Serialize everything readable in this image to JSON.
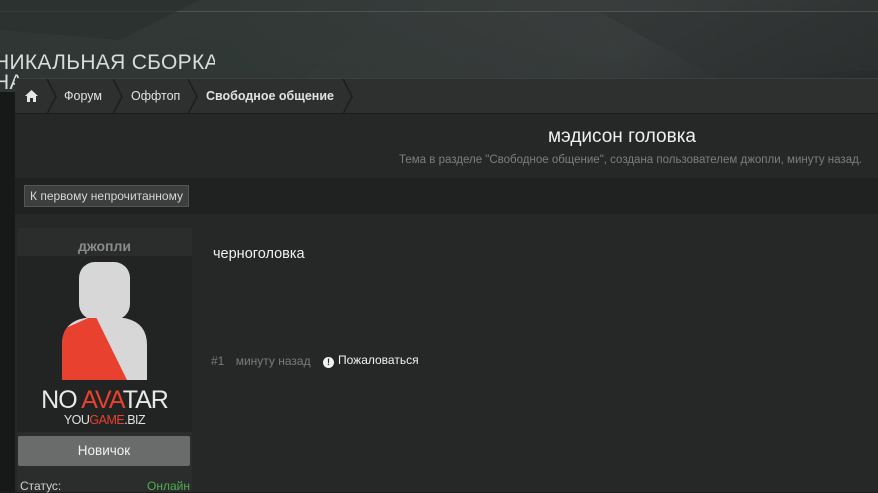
{
  "site": {
    "banner_line1": "НИКАЛЬНАЯ СБОРКА",
    "banner_line2": "НА"
  },
  "breadcrumb": {
    "home_icon": "home-icon",
    "items": [
      "Форум",
      "Оффтоп",
      "Свободное общение"
    ]
  },
  "thread": {
    "title": "мэдисон головка",
    "subtitle": "Тема в разделе \"Свободное общение\", создана пользователем джопли, минуту назад."
  },
  "toolbar": {
    "first_unread": "К первому непрочитанному"
  },
  "user": {
    "name": "джопли",
    "avatar_text_no": "NO ",
    "avatar_text_ava": "AVA",
    "avatar_text_tar": "TAR",
    "avatar_sub_you": "YOU",
    "avatar_sub_game": "GAME",
    "avatar_sub_biz": ".BIZ",
    "rank": "Новичок",
    "status_label": "Статус:",
    "status_value": "Онлайн",
    "status_color": "#4caf50"
  },
  "post": {
    "message": "черноголовка",
    "number": "#1",
    "time": "минуту назад",
    "report": "Пожаловаться"
  }
}
